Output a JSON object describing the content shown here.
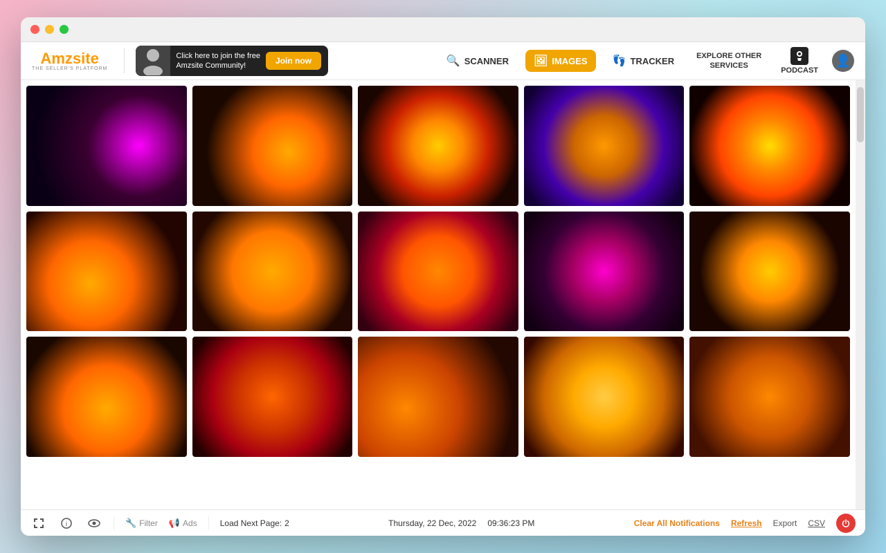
{
  "window": {
    "title": "Amzsite"
  },
  "titlebar": {
    "close": "×",
    "minimize": "–",
    "maximize": "+"
  },
  "logo": {
    "prefix": "Amz",
    "suffix": "site",
    "tagline": "THE SELLER'S PLATFORM"
  },
  "promo": {
    "text_line1": "Click here to join the free",
    "text_line2": "Amzsite Community!",
    "join_label": "Join now"
  },
  "nav": {
    "scanner_label": "SCANNER",
    "scanner_icon": "🔍",
    "images_label": "IMAGES",
    "images_icon": "🖼",
    "tracker_label": "TRACKER",
    "tracker_icon": "👣",
    "explore_label": "EXPLORE OTHER\nSERVICES",
    "podcast_label": "PODCAST"
  },
  "grid": {
    "images": [
      {
        "id": 1,
        "cls": "img1"
      },
      {
        "id": 2,
        "cls": "img2"
      },
      {
        "id": 3,
        "cls": "img3"
      },
      {
        "id": 4,
        "cls": "img4"
      },
      {
        "id": 5,
        "cls": "img5"
      },
      {
        "id": 6,
        "cls": "img6"
      },
      {
        "id": 7,
        "cls": "img7"
      },
      {
        "id": 8,
        "cls": "img8"
      },
      {
        "id": 9,
        "cls": "img9"
      },
      {
        "id": 10,
        "cls": "img10"
      },
      {
        "id": 11,
        "cls": "img11"
      },
      {
        "id": 12,
        "cls": "img12"
      },
      {
        "id": 13,
        "cls": "img13"
      },
      {
        "id": 14,
        "cls": "img14"
      },
      {
        "id": 15,
        "cls": "img15"
      }
    ]
  },
  "bottombar": {
    "load_next_label": "Load Next Page:",
    "load_next_page": "2",
    "date": "Thursday, 22 Dec, 2022",
    "time": "09:36:23 PM",
    "clear_notifications": "Clear All Notifications",
    "refresh": "Refresh",
    "export": "Export",
    "csv": "CSV",
    "filter_label": "Filter",
    "ads_label": "Ads"
  }
}
